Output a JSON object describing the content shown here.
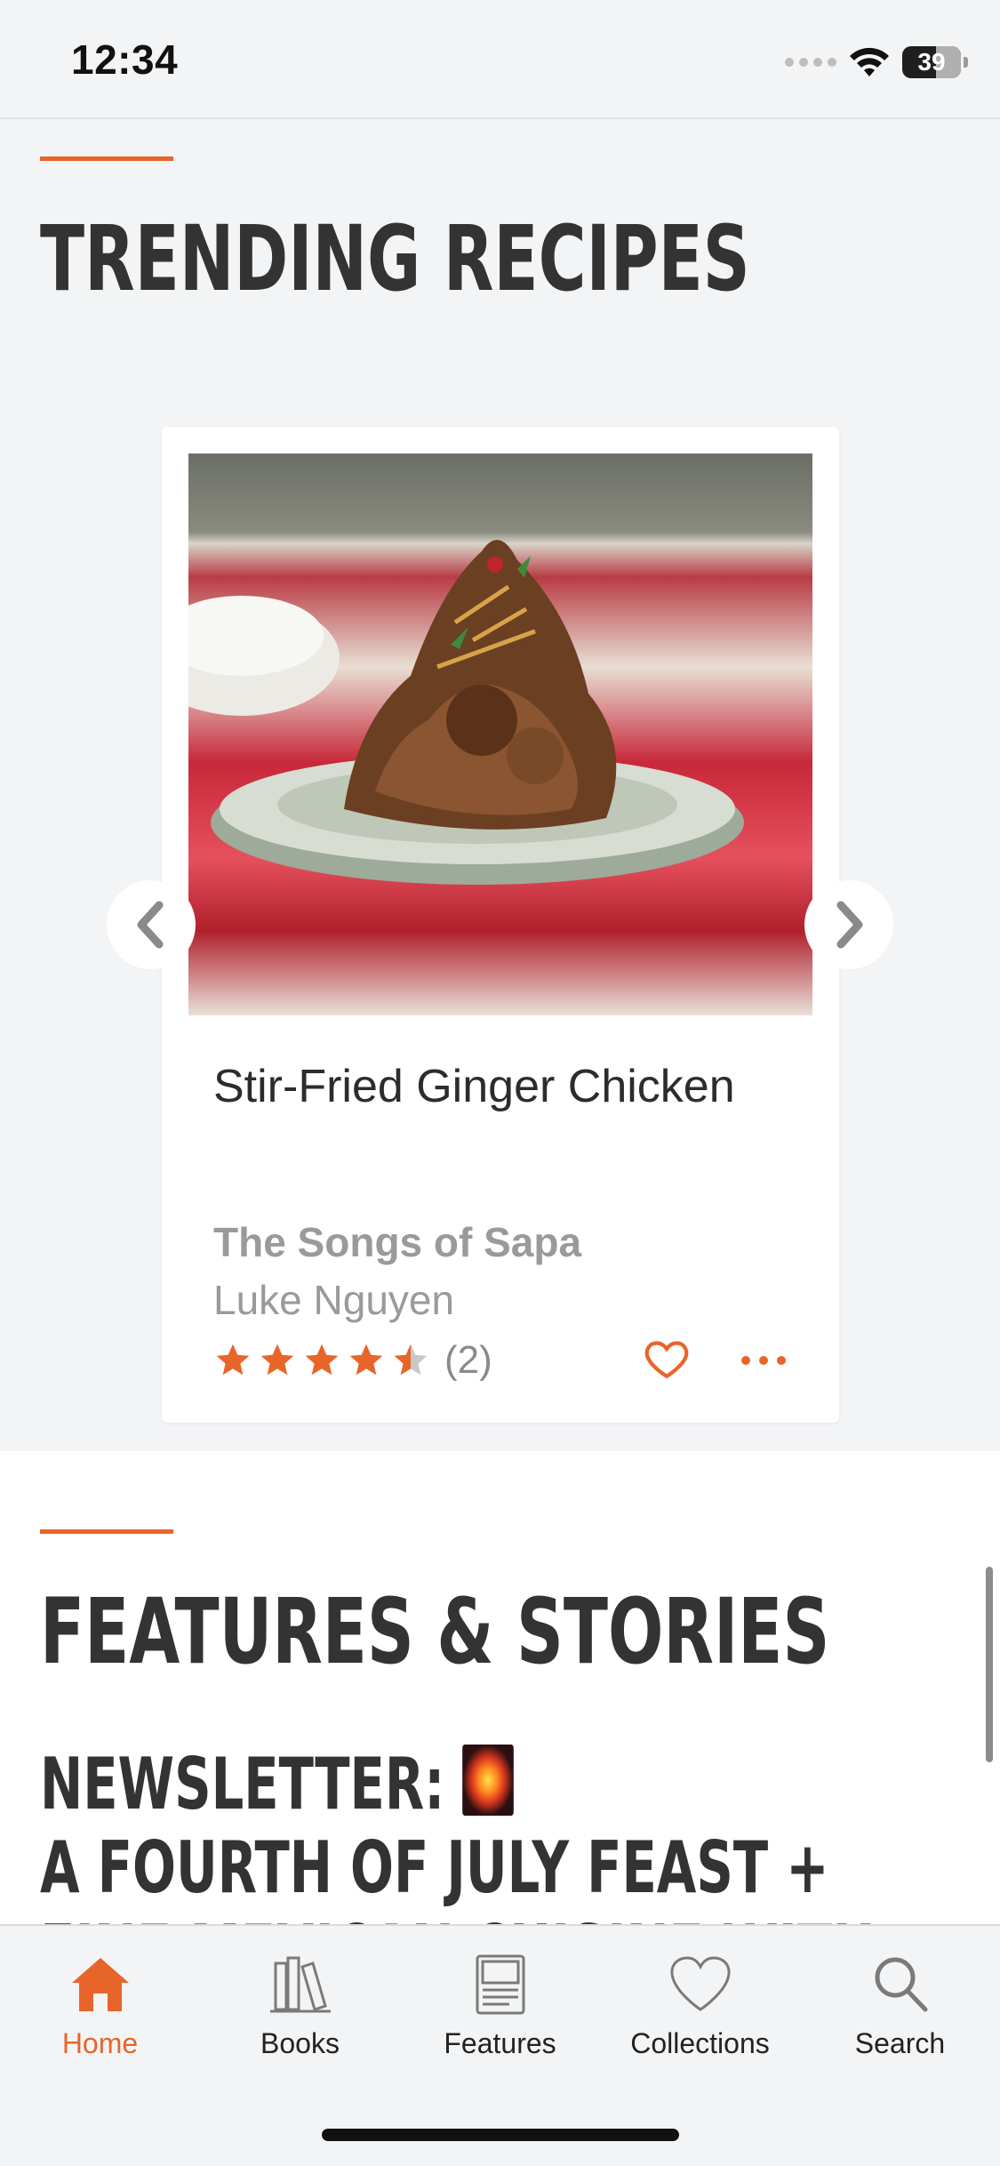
{
  "status_bar": {
    "time": "12:34",
    "battery": "39"
  },
  "trending": {
    "heading": "Trending Recipes",
    "card": {
      "image_alt": "Plate of stir-fried ginger chicken on a red patterned cloth",
      "title": "Stir-Fried Ginger Chicken",
      "book": "The Songs of Sapa",
      "author": "Luke Nguyen",
      "rating": 4.5,
      "rating_count": "(2)"
    }
  },
  "features": {
    "heading": "Features & Stories",
    "story": {
      "prefix": "Newsletter:",
      "emoji_icon": "firework-icon",
      "rest": "A Fourth of July Feast + Fine Mexican Cuisine with Our"
    }
  },
  "tab_bar": {
    "items": [
      {
        "label": "Home",
        "icon": "home-icon",
        "active": true
      },
      {
        "label": "Books",
        "icon": "books-icon",
        "active": false
      },
      {
        "label": "Features",
        "icon": "features-icon",
        "active": false
      },
      {
        "label": "Collections",
        "icon": "heart-icon",
        "active": false
      },
      {
        "label": "Search",
        "icon": "search-icon",
        "active": false
      }
    ]
  },
  "colors": {
    "accent": "#e8652a",
    "background": "#f3f4f6",
    "text": "#2b2b2b",
    "muted": "#9a9a9a"
  }
}
